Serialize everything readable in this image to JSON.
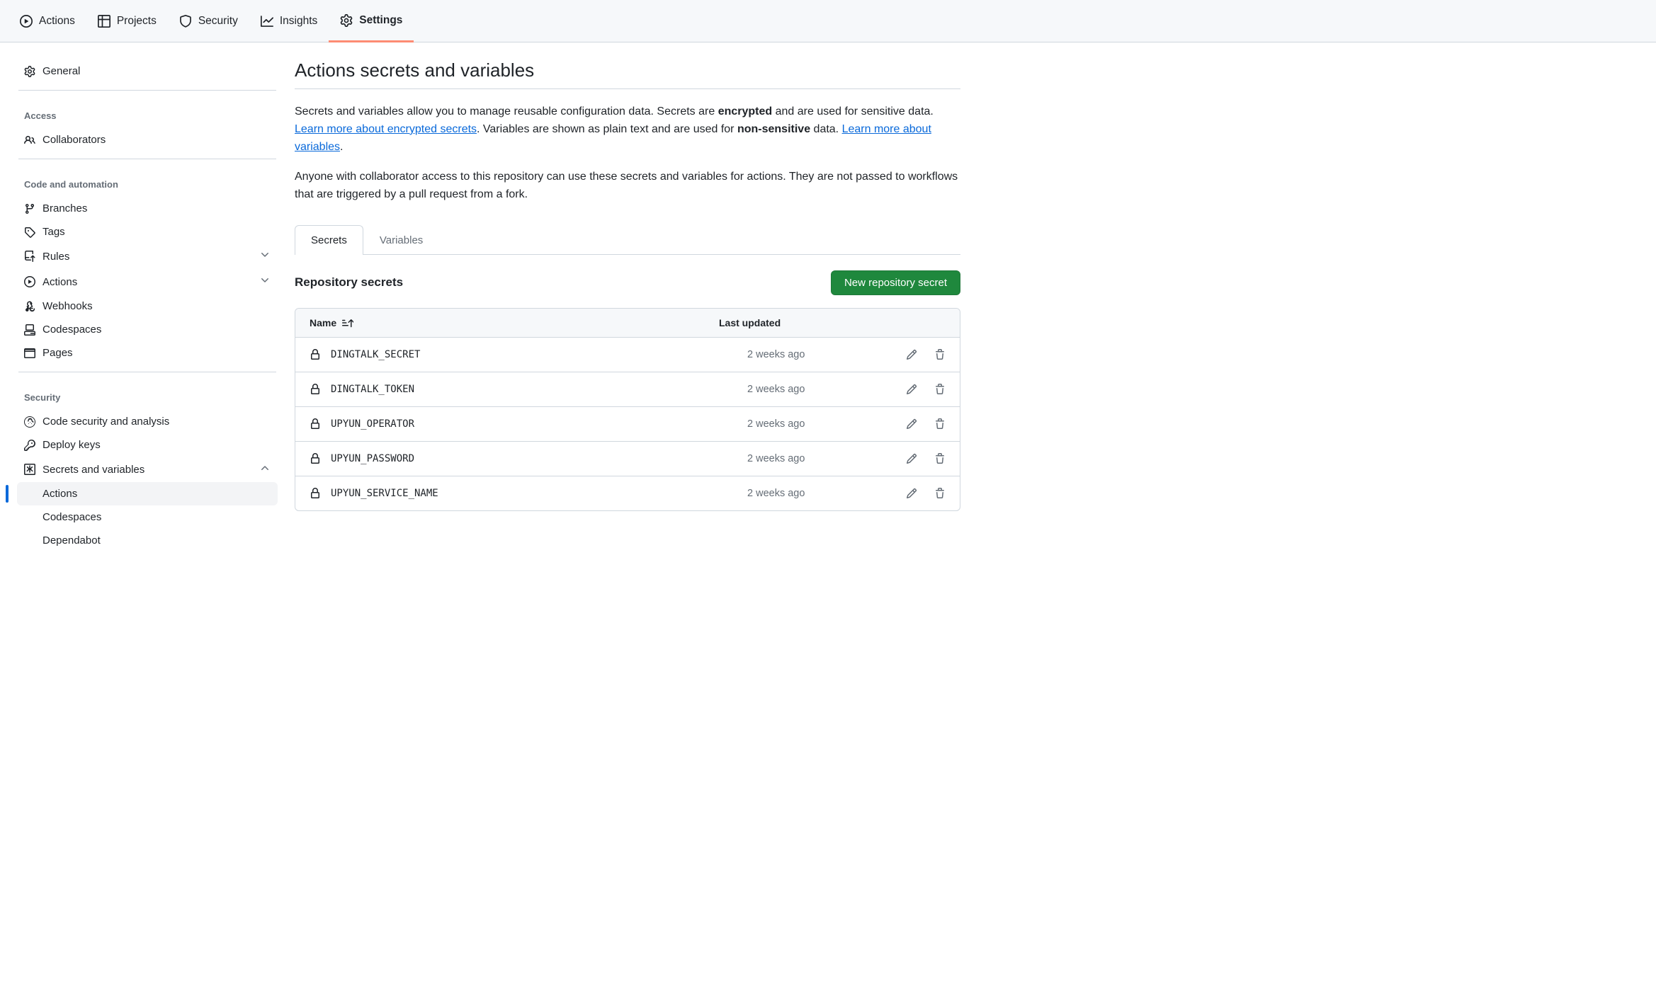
{
  "topnav": {
    "actions": "Actions",
    "projects": "Projects",
    "security": "Security",
    "insights": "Insights",
    "settings": "Settings"
  },
  "sidebar": {
    "general": "General",
    "access_title": "Access",
    "collaborators": "Collaborators",
    "code_title": "Code and automation",
    "branches": "Branches",
    "tags": "Tags",
    "rules": "Rules",
    "actions": "Actions",
    "webhooks": "Webhooks",
    "codespaces": "Codespaces",
    "pages": "Pages",
    "security_title": "Security",
    "code_security": "Code security and analysis",
    "deploy_keys": "Deploy keys",
    "secrets_vars": "Secrets and variables",
    "sv_actions": "Actions",
    "sv_codespaces": "Codespaces",
    "sv_dependabot": "Dependabot"
  },
  "main": {
    "title": "Actions secrets and variables",
    "desc_p1a": "Secrets and variables allow you to manage reusable configuration data. Secrets are ",
    "desc_p1b": "encrypted",
    "desc_p1c": " and are used for sensitive data. ",
    "desc_link1": "Learn more about encrypted secrets",
    "desc_p1d": ". Variables are shown as plain text and are used for ",
    "desc_p1e": "non-sensitive",
    "desc_p1f": " data. ",
    "desc_link2": "Learn more about variables",
    "desc_p1g": ".",
    "desc_p2": "Anyone with collaborator access to this repository can use these secrets and variables for actions. They are not passed to workflows that are triggered by a pull request from a fork.",
    "tab_secrets": "Secrets",
    "tab_variables": "Variables",
    "section_title": "Repository secrets",
    "new_btn": "New repository secret",
    "th_name": "Name",
    "th_updated": "Last updated"
  },
  "secrets": [
    {
      "name": "DINGTALK_SECRET",
      "updated": "2 weeks ago"
    },
    {
      "name": "DINGTALK_TOKEN",
      "updated": "2 weeks ago"
    },
    {
      "name": "UPYUN_OPERATOR",
      "updated": "2 weeks ago"
    },
    {
      "name": "UPYUN_PASSWORD",
      "updated": "2 weeks ago"
    },
    {
      "name": "UPYUN_SERVICE_NAME",
      "updated": "2 weeks ago"
    }
  ]
}
